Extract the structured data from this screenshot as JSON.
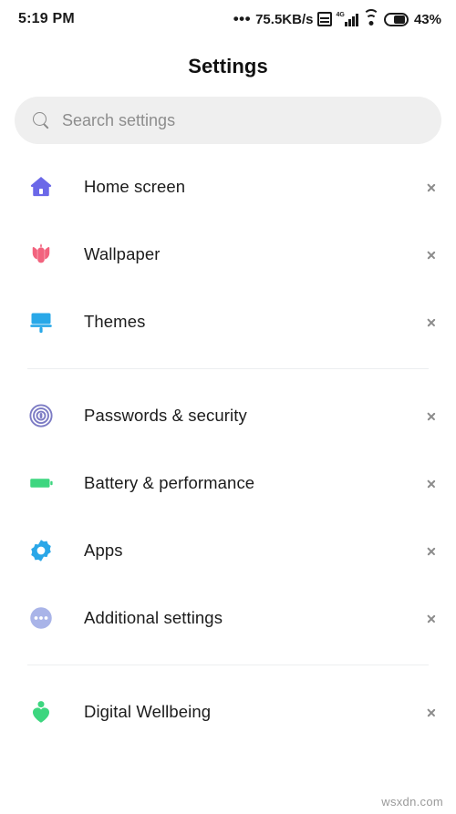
{
  "status_bar": {
    "time": "5:19 PM",
    "dots": "•••",
    "network_speed": "75.5KB/s",
    "sim_icon": "sim-card-icon",
    "signal_label": "4G",
    "signal_icon": "cellular-signal-icon",
    "wifi_icon": "wifi-icon",
    "battery_icon": "battery-icon",
    "battery_percent": "43%"
  },
  "header": {
    "title": "Settings"
  },
  "search": {
    "icon": "search-icon",
    "placeholder": "Search settings",
    "value": ""
  },
  "groups": [
    {
      "id": "personalization",
      "items": [
        {
          "label": "Home screen",
          "icon": "home-icon",
          "color": "#6B68E8"
        },
        {
          "label": "Wallpaper",
          "icon": "tulip-flower-icon",
          "color": "#F2637E"
        },
        {
          "label": "Themes",
          "icon": "paint-brush-icon",
          "color": "#29A8E8"
        }
      ]
    },
    {
      "id": "system",
      "items": [
        {
          "label": "Passwords & security",
          "icon": "fingerprint-icon",
          "color": "#7C7BC4"
        },
        {
          "label": "Battery & performance",
          "icon": "battery-icon",
          "color": "#3DD67F"
        },
        {
          "label": "Apps",
          "icon": "gear-icon",
          "color": "#2AA7E8"
        },
        {
          "label": "Additional settings",
          "icon": "more-horizontal-icon",
          "color": "#A9B4E8"
        }
      ]
    },
    {
      "id": "wellbeing",
      "items": [
        {
          "label": "Digital Wellbeing",
          "icon": "heart-person-icon",
          "color": "#3DD67F"
        }
      ]
    }
  ],
  "watermark": "wsxdn.com",
  "colors": {
    "background": "#FFFFFF",
    "text_primary": "#1C1C1C",
    "text_muted": "#8D8D8D",
    "search_bg": "#EFEFEF",
    "divider": "#ECEEF0"
  }
}
